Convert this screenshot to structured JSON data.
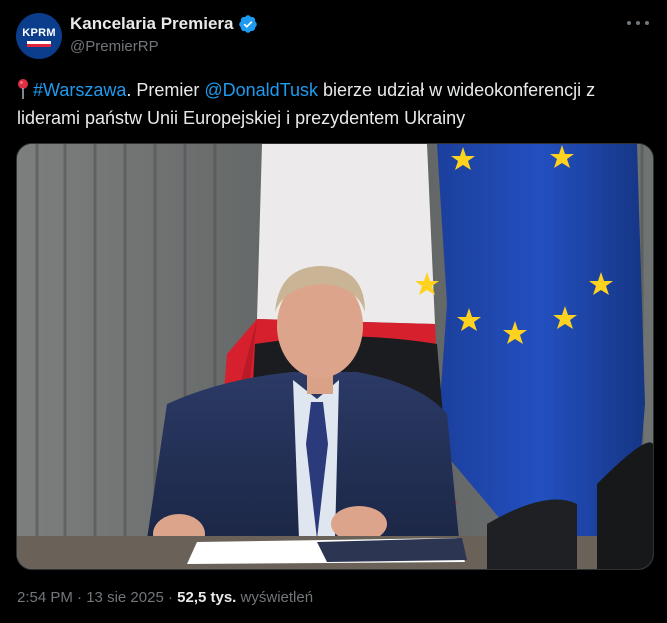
{
  "author": {
    "display_name": "Kancelaria Premiera",
    "handle": "@PremierRP",
    "avatar_text": "KPRM",
    "verified": true,
    "avatar_color": "#0a3d8c"
  },
  "tweet": {
    "hashtag": "#Warszawa",
    "text_1": ". Premier ",
    "mention": "@DonaldTusk",
    "text_2": " bierze udział w wideokonferencji z liderami państw Unii Europejskiej i prezydentem Ukrainy",
    "link_color": "#1d9bf0"
  },
  "media": {
    "icon": "photo"
  },
  "meta": {
    "time": "2:54 PM",
    "sep1": " · ",
    "date": "13 sie 2025",
    "sep2": " · ",
    "views_count": "52,5 tys.",
    "views_label": " wyświetleń"
  },
  "icons": {
    "verified": "verified-badge-icon",
    "more": "more-dots-icon",
    "pin": "round-pushpin-icon"
  }
}
